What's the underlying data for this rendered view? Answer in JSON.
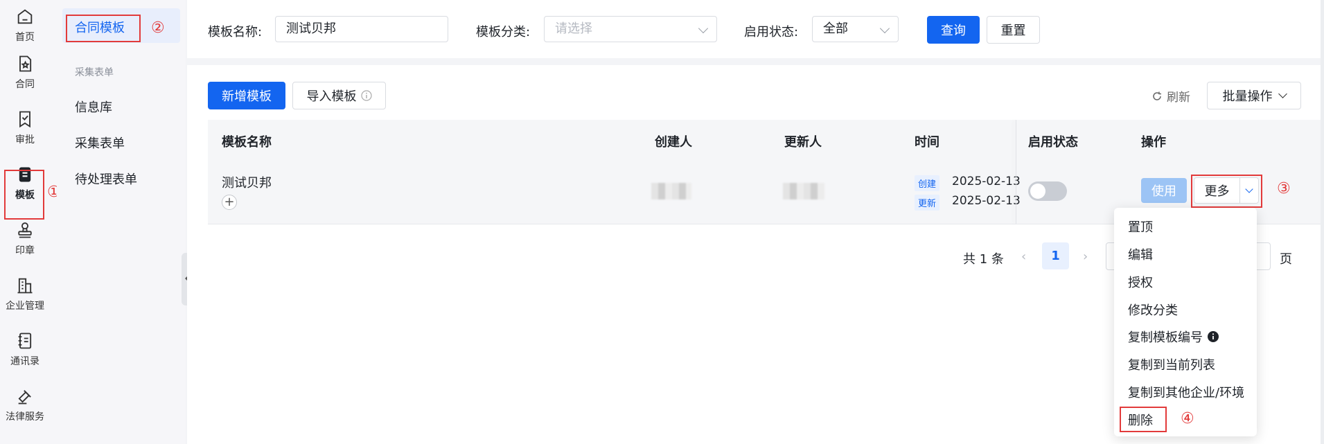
{
  "rail": {
    "items": [
      {
        "label": "首页",
        "icon": "home-icon"
      },
      {
        "label": "合同",
        "icon": "contract-icon"
      },
      {
        "label": "审批",
        "icon": "approval-icon"
      },
      {
        "label": "模板",
        "icon": "template-icon"
      },
      {
        "label": "印章",
        "icon": "seal-icon"
      },
      {
        "label": "企业管理",
        "icon": "building-icon"
      },
      {
        "label": "通讯录",
        "icon": "contacts-icon"
      },
      {
        "label": "法律服务",
        "icon": "legal-icon"
      }
    ]
  },
  "annotations": {
    "n1": "①",
    "n2": "②",
    "n3": "③",
    "n4": "④"
  },
  "subnav": {
    "active": "合同模板",
    "group_label": "采集表单",
    "items": [
      "信息库",
      "采集表单",
      "待处理表单"
    ]
  },
  "filters": {
    "name_label": "模板名称:",
    "name_value": "测试贝邦",
    "category_label": "模板分类:",
    "category_placeholder": "请选择",
    "status_label": "启用状态:",
    "status_value": "全部",
    "query_button": "查询",
    "reset_button": "重置"
  },
  "toolbar": {
    "add_button": "新增模板",
    "import_button": "导入模板",
    "refresh": "刷新",
    "batch": "批量操作"
  },
  "table": {
    "headers": [
      "模板名称",
      "创建人",
      "更新人",
      "时间",
      "启用状态",
      "操作"
    ],
    "rows": [
      {
        "name": "测试贝邦",
        "created_tag": "创建",
        "created_time": "2025-02-13",
        "updated_tag": "更新",
        "updated_time": "2025-02-13",
        "enabled": false,
        "use_button": "使用",
        "more_button": "更多"
      }
    ]
  },
  "pager": {
    "total": "共 1 条",
    "current": "1",
    "suffix": "页"
  },
  "more_menu": {
    "items": [
      "置顶",
      "编辑",
      "授权",
      "修改分类",
      "复制模板编号",
      "复制到当前列表",
      "复制到其他企业/环境",
      "删除"
    ]
  },
  "colors": {
    "primary": "#1365f0",
    "annotation": "#e23a3a"
  }
}
